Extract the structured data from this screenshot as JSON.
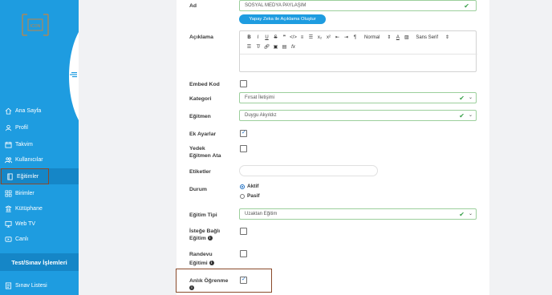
{
  "sidebar": {
    "logo_text": "ICON",
    "items": [
      {
        "label": "Ana Sayfa",
        "icon": "home-icon"
      },
      {
        "label": "Profil",
        "icon": "user-icon"
      },
      {
        "label": "Takvim",
        "icon": "calendar-icon"
      },
      {
        "label": "Kullanıcılar",
        "icon": "users-icon"
      },
      {
        "label": "Eğitimler",
        "icon": "book-icon"
      },
      {
        "label": "Birimler",
        "icon": "grid-icon"
      },
      {
        "label": "Kütüphane",
        "icon": "library-icon"
      },
      {
        "label": "Web TV",
        "icon": "tv-icon"
      },
      {
        "label": "Canlı",
        "icon": "live-icon"
      }
    ],
    "section_title": "Test/Sınav İşlemleri",
    "bottom_item": {
      "label": "Sınav Listesi",
      "icon": "exam-icon"
    }
  },
  "form": {
    "ad_label": "Ad",
    "ad_value": "SOSYAL MEDYA PAYLAŞIM",
    "ai_button": "Yapay Zeka ile Açıklama Oluştur",
    "aciklama_label": "Açıklama",
    "editor": {
      "format_select": "Normal",
      "font_select": "Sans Serif"
    },
    "embed_label": "Embed Kod",
    "kategori_label": "Kategori",
    "kategori_value": "Fırsat İletişimi",
    "egitmen_label": "Eğitmen",
    "egitmen_value": "Duygu Akyıldız",
    "ek_ayarlar_label": "Ek Ayarlar",
    "yedek_label_1": "Yedek",
    "yedek_label_2": "Eğitmen Ata",
    "etiketler_label": "Etiketler",
    "durum_label": "Durum",
    "durum_aktif": "Aktif",
    "durum_pasif": "Pasif",
    "egitim_tipi_label": "Eğitim Tipi",
    "egitim_tipi_value": "Uzaktan Eğitim",
    "istege_label_1": "İsteğe Bağlı",
    "istege_label_2": "Eğitim",
    "randevu_label_1": "Randevu",
    "randevu_label_2": "Eğitimi",
    "anlik_label": "Anlık Öğrenme"
  },
  "colors": {
    "sidebar": "#1e9ce0",
    "sidebar_active": "#1586c7",
    "valid_border": "#9ccf9c",
    "check_green": "#3aa04a",
    "highlight": "#8a4a2a"
  }
}
